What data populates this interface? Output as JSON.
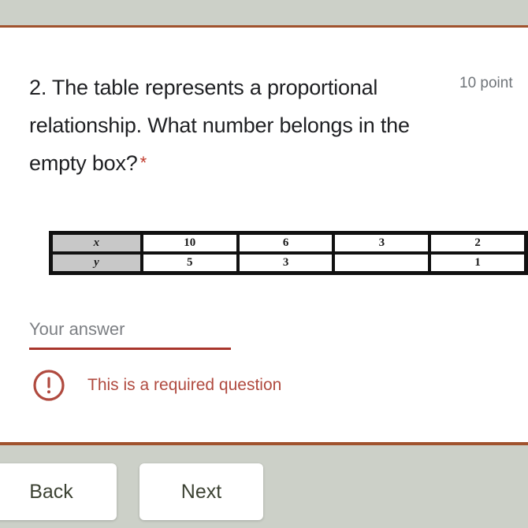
{
  "form": {
    "question_number_text": "2. The table represents a proportional relationship. What number belongs in the empty box?",
    "required_marker": "*",
    "points_label": "10 point",
    "accent_color": "#a0522d",
    "error_color": "#b04a3f",
    "page_background": "#ccd0c8",
    "card_background": "#ffffff"
  },
  "table": {
    "rows": [
      {
        "header": "x",
        "cells": [
          "10",
          "6",
          "3",
          "2"
        ]
      },
      {
        "header": "y",
        "cells": [
          "5",
          "3",
          "",
          "1"
        ]
      }
    ]
  },
  "answer": {
    "placeholder": "Your answer",
    "value": ""
  },
  "error": {
    "icon": "error-exclamation-icon",
    "message": "This is a required question"
  },
  "navigation": {
    "back_label": "Back",
    "next_label": "Next"
  }
}
